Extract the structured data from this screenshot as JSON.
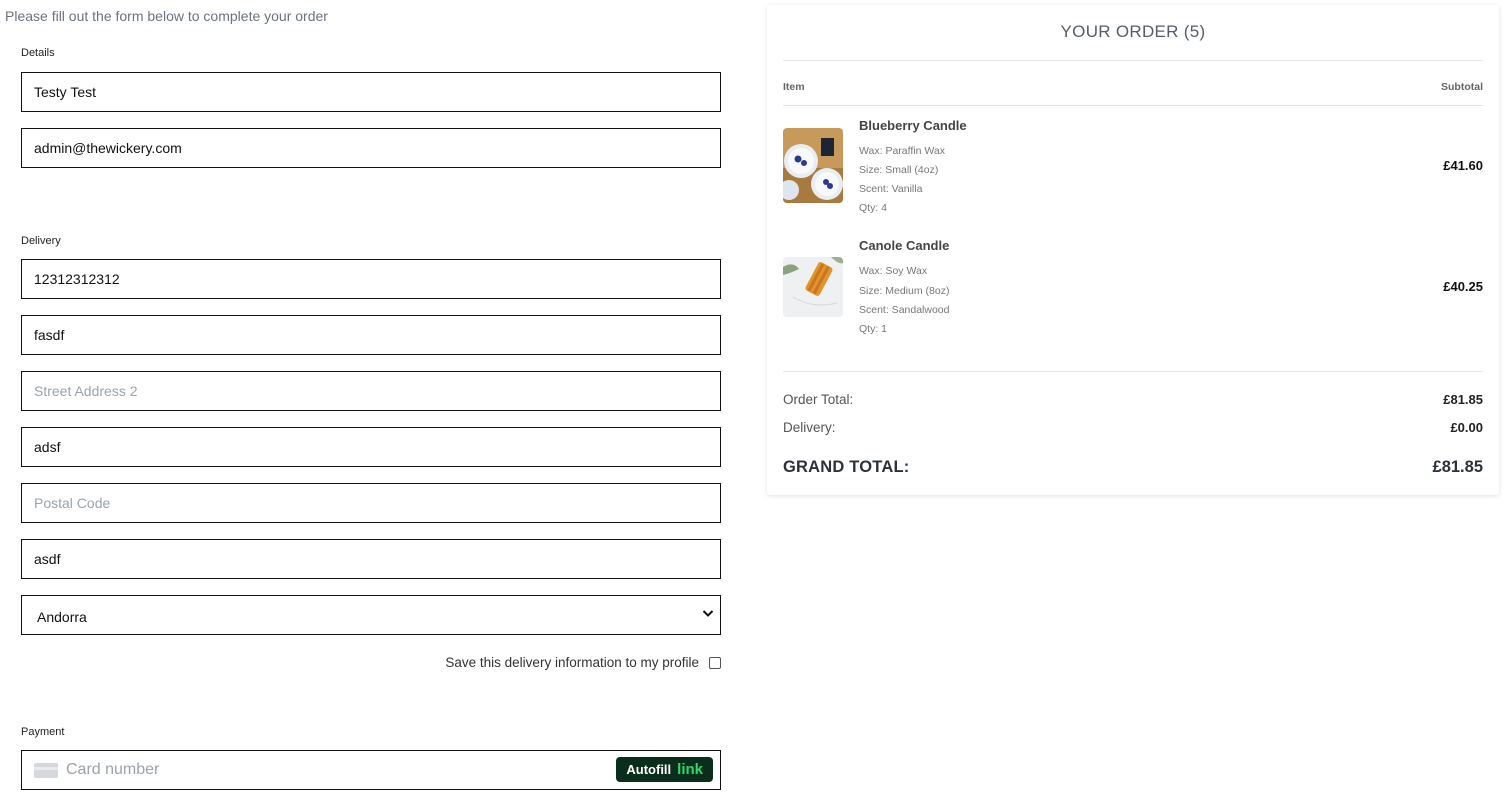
{
  "intro": "Please fill out the form below to complete your order",
  "details": {
    "label": "Details",
    "full_name": "Testy Test",
    "email": "admin@thewickery.com"
  },
  "delivery": {
    "label": "Delivery",
    "phone": "12312312312",
    "street1": "fasdf",
    "street2_placeholder": "Street Address 2",
    "town": "adsf",
    "postal_placeholder": "Postal Code",
    "county": "asdf",
    "country": "Andorra",
    "save_label": "Save this delivery information to my profile"
  },
  "payment": {
    "label": "Payment",
    "card_placeholder": "Card number",
    "autofill_text": "Autofill",
    "link_text": "link"
  },
  "order": {
    "title": "YOUR ORDER (5)",
    "col_item": "Item",
    "col_subtotal": "Subtotal",
    "items": [
      {
        "name": "Blueberry Candle",
        "wax": "Wax: Paraffin Wax",
        "size": "Size: Small (4oz)",
        "scent": "Scent: Vanilla",
        "qty": "Qty: 4",
        "subtotal": "£41.60"
      },
      {
        "name": "Canole Candle",
        "wax": "Wax: Soy Wax",
        "size": "Size: Medium (8oz)",
        "scent": "Scent: Sandalwood",
        "qty": "Qty: 1",
        "subtotal": "£40.25"
      }
    ],
    "order_total_label": "Order Total:",
    "order_total": "£81.85",
    "delivery_label": "Delivery:",
    "delivery_cost": "£0.00",
    "grand_total_label": "GRAND TOTAL:",
    "grand_total": "£81.85"
  }
}
